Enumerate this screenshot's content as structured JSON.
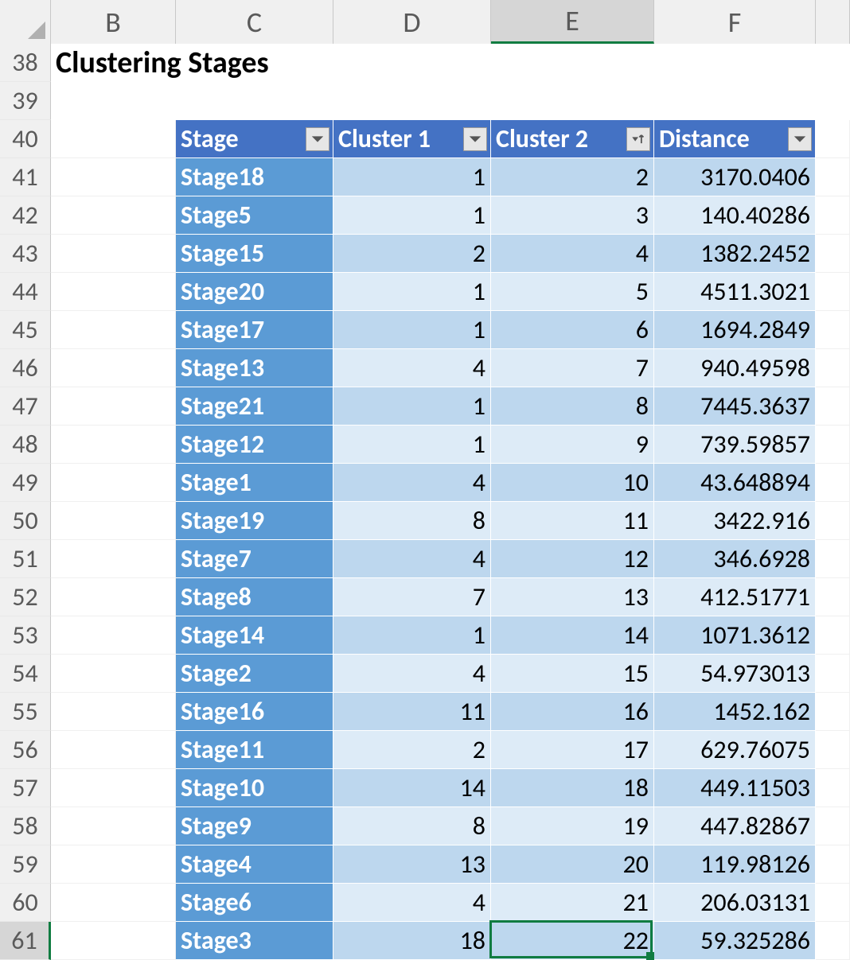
{
  "columns": {
    "B": "B",
    "C": "C",
    "D": "D",
    "E": "E",
    "F": "F"
  },
  "rownums": [
    "38",
    "39",
    "40",
    "41",
    "42",
    "43",
    "44",
    "45",
    "46",
    "47",
    "48",
    "49",
    "50",
    "51",
    "52",
    "53",
    "54",
    "55",
    "56",
    "57",
    "58",
    "59",
    "60",
    "61"
  ],
  "title": "Clustering Stages",
  "active_cell": {
    "row": "61",
    "col": "E",
    "value": "22"
  },
  "table": {
    "headers": {
      "stage": "Stage",
      "c1": "Cluster 1",
      "c2": "Cluster 2",
      "dist": "Distance"
    },
    "sorted_col": "c2",
    "rows": [
      {
        "stage": "Stage18",
        "c1": "1",
        "c2": "2",
        "dist": "3170.0406"
      },
      {
        "stage": "Stage5",
        "c1": "1",
        "c2": "3",
        "dist": "140.40286"
      },
      {
        "stage": "Stage15",
        "c1": "2",
        "c2": "4",
        "dist": "1382.2452"
      },
      {
        "stage": "Stage20",
        "c1": "1",
        "c2": "5",
        "dist": "4511.3021"
      },
      {
        "stage": "Stage17",
        "c1": "1",
        "c2": "6",
        "dist": "1694.2849"
      },
      {
        "stage": "Stage13",
        "c1": "4",
        "c2": "7",
        "dist": "940.49598"
      },
      {
        "stage": "Stage21",
        "c1": "1",
        "c2": "8",
        "dist": "7445.3637"
      },
      {
        "stage": "Stage12",
        "c1": "1",
        "c2": "9",
        "dist": "739.59857"
      },
      {
        "stage": "Stage1",
        "c1": "4",
        "c2": "10",
        "dist": "43.648894"
      },
      {
        "stage": "Stage19",
        "c1": "8",
        "c2": "11",
        "dist": "3422.916"
      },
      {
        "stage": "Stage7",
        "c1": "4",
        "c2": "12",
        "dist": "346.6928"
      },
      {
        "stage": "Stage8",
        "c1": "7",
        "c2": "13",
        "dist": "412.51771"
      },
      {
        "stage": "Stage14",
        "c1": "1",
        "c2": "14",
        "dist": "1071.3612"
      },
      {
        "stage": "Stage2",
        "c1": "4",
        "c2": "15",
        "dist": "54.973013"
      },
      {
        "stage": "Stage16",
        "c1": "11",
        "c2": "16",
        "dist": "1452.162"
      },
      {
        "stage": "Stage11",
        "c1": "2",
        "c2": "17",
        "dist": "629.76075"
      },
      {
        "stage": "Stage10",
        "c1": "14",
        "c2": "18",
        "dist": "449.11503"
      },
      {
        "stage": "Stage9",
        "c1": "8",
        "c2": "19",
        "dist": "447.82867"
      },
      {
        "stage": "Stage4",
        "c1": "13",
        "c2": "20",
        "dist": "119.98126"
      },
      {
        "stage": "Stage6",
        "c1": "4",
        "c2": "21",
        "dist": "206.03131"
      },
      {
        "stage": "Stage3",
        "c1": "18",
        "c2": "22",
        "dist": "59.325286"
      }
    ]
  }
}
